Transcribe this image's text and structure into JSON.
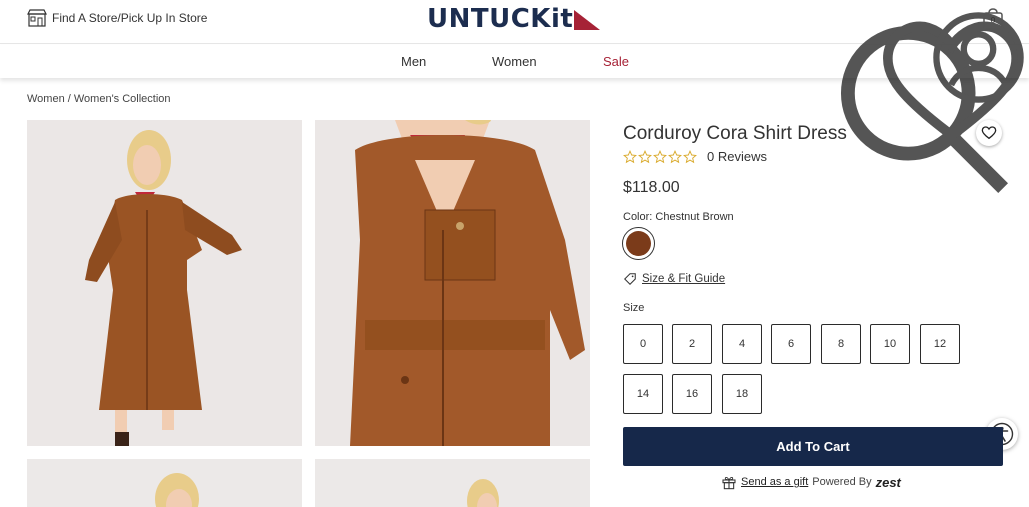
{
  "header": {
    "store_link": "Find A Store/Pick Up In Store",
    "logo_text": "UNTUCKit",
    "cart_count": "0",
    "brand_color": "#1c2d4f",
    "accent_color": "#a62236"
  },
  "nav": {
    "items": [
      {
        "label": "Men"
      },
      {
        "label": "Women"
      },
      {
        "label": "Sale"
      }
    ]
  },
  "breadcrumb": "Women / Women's Collection",
  "product": {
    "title": "Corduroy Cora Shirt Dress",
    "rating": 0,
    "reviews": "0 Reviews",
    "price": "$118.00",
    "color_label": "Color: Chestnut Brown",
    "swatch_color": "#7b3b1a",
    "size_guide": "Size & Fit Guide",
    "size_label": "Size",
    "sizes": [
      "0",
      "2",
      "4",
      "6",
      "8",
      "10",
      "12",
      "14",
      "16",
      "18"
    ],
    "add_to_cart": "Add To Cart",
    "gift_link": "Send as a gift",
    "powered_by": "Powered By",
    "zest": "zest"
  }
}
